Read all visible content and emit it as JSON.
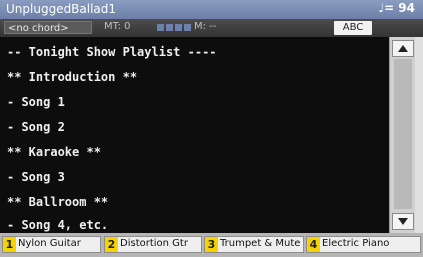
{
  "header": {
    "song_title": "UnpluggedBallad1",
    "tempo": "♩= 94"
  },
  "status": {
    "chord": "<no chord>",
    "mt": "MT: 0",
    "measure": "M: --",
    "abc_button": "ABC"
  },
  "lyrics": {
    "lines": [
      "-- Tonight Show Playlist ----",
      "** Introduction **",
      "- Song 1",
      "- Song 2",
      "** Karaoke **",
      "- Song 3",
      "** Ballroom **",
      "- Song 4, etc."
    ]
  },
  "tabs": [
    {
      "num": "1",
      "label": "Nylon Guitar"
    },
    {
      "num": "2",
      "label": "Distortion Gtr"
    },
    {
      "num": "3",
      "label": "Trumpet & Mute"
    },
    {
      "num": "4",
      "label": "Electric Piano"
    }
  ]
}
